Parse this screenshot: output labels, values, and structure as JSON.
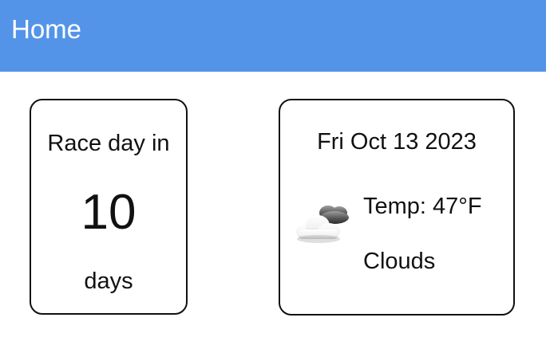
{
  "header": {
    "title": "Home"
  },
  "countdown": {
    "label": "Race day in",
    "value": "10",
    "unit": "days"
  },
  "weather": {
    "date": "Fri Oct 13 2023",
    "temperature": "Temp: 47°F",
    "condition": "Clouds",
    "icon": "cloud-icon"
  },
  "colors": {
    "header_background": "#5494e8",
    "card_border": "#111111",
    "text": "#111111",
    "header_text": "#ffffff"
  }
}
